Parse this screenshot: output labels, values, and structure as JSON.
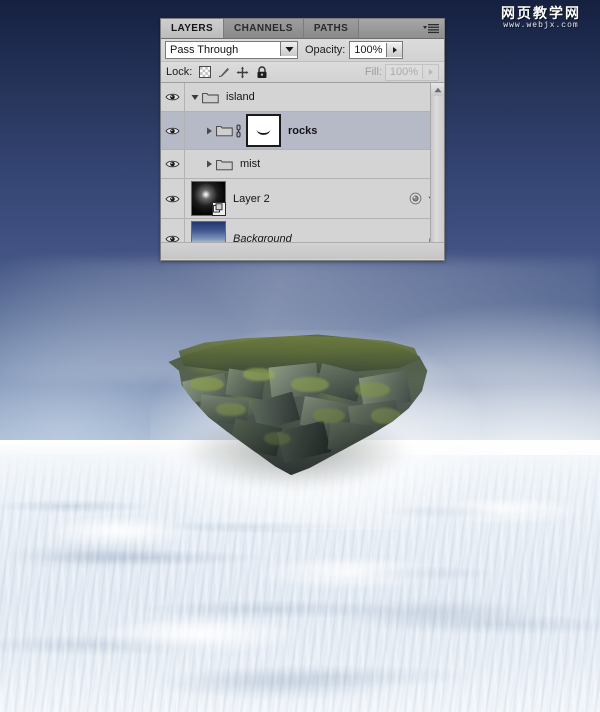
{
  "app": {
    "panel_title": "LAYERS",
    "tabs": [
      {
        "label": "LAYERS",
        "active": true
      },
      {
        "label": "CHANNELS",
        "active": false
      },
      {
        "label": "PATHS",
        "active": false
      }
    ],
    "panel_menu_icon": "panel-menu-icon"
  },
  "blend": {
    "mode_value": "Pass Through",
    "opacity_label": "Opacity:",
    "opacity_value": "100%",
    "dropdown_icon": "chevron-down-icon",
    "spinner_icon": "chevron-right-icon"
  },
  "lock": {
    "label": "Lock:",
    "icons": [
      {
        "name": "lock-transparent-pixels-icon",
        "glyph": "checkerboard"
      },
      {
        "name": "lock-image-pixels-icon",
        "glyph": "brush"
      },
      {
        "name": "lock-position-icon",
        "glyph": "move-cross"
      },
      {
        "name": "lock-all-icon",
        "glyph": "padlock"
      }
    ],
    "fill_label": "Fill:",
    "fill_value": "100%",
    "fill_disabled": true
  },
  "layers": [
    {
      "name": "island",
      "type": "group",
      "visible": true,
      "expanded": true,
      "selected": false,
      "indent": 0,
      "bold": false,
      "italic": false,
      "thumb": "none",
      "eye_icon": "eye-icon",
      "disclosure_icon": "triangle-down-icon",
      "folder_icon": "folder-icon",
      "linked": false,
      "right_icons": []
    },
    {
      "name": "rocks",
      "type": "group",
      "visible": true,
      "expanded": false,
      "selected": true,
      "indent": 1,
      "bold": true,
      "italic": false,
      "thumb": "mask",
      "eye_icon": "eye-icon",
      "disclosure_icon": "triangle-right-icon",
      "folder_icon": "folder-icon",
      "linked": true,
      "link_icon": "link-icon",
      "right_icons": []
    },
    {
      "name": "mist",
      "type": "group",
      "visible": true,
      "expanded": false,
      "selected": false,
      "indent": 1,
      "bold": false,
      "italic": false,
      "thumb": "none",
      "eye_icon": "eye-icon",
      "disclosure_icon": "triangle-right-icon",
      "folder_icon": "folder-icon",
      "linked": false,
      "right_icons": []
    },
    {
      "name": "Layer 2",
      "type": "layer",
      "visible": true,
      "expanded": false,
      "selected": false,
      "indent": 0,
      "bold": false,
      "italic": false,
      "thumb": "glow",
      "eye_icon": "eye-icon",
      "smart_object_badge": "smart-object-icon",
      "right_icons": [
        {
          "name": "layer-style-icon"
        },
        {
          "name": "triangle-down-icon"
        }
      ]
    },
    {
      "name": "Background",
      "type": "layer",
      "visible": true,
      "expanded": false,
      "selected": false,
      "indent": 0,
      "bold": false,
      "italic": true,
      "thumb": "sky",
      "eye_icon": "eye-icon",
      "right_icons": [
        {
          "name": "lock-badge-icon"
        }
      ]
    }
  ],
  "scrollbar": {
    "up_arrow_icon": "scroll-up-icon"
  },
  "watermark": {
    "text_cn": "网页教学网",
    "url": "www.webjx.com"
  },
  "canvas": {
    "subject": "floating rock island above cloud sea",
    "sky_top_color": "#16203f",
    "sky_bottom_color": "#ffffff",
    "cloud_color": "#e9eff6",
    "rock_color": "#4c5850",
    "moss_color": "#6f7d3e"
  }
}
